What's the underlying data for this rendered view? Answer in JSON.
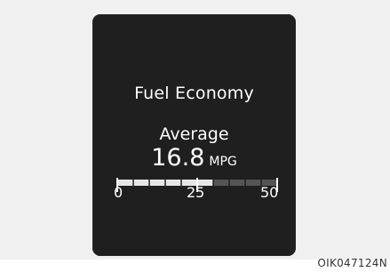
{
  "display": {
    "title": "Fuel Economy",
    "mode_label": "Average",
    "value": "16.8",
    "unit": "MPG"
  },
  "gauge": {
    "min_label": "0",
    "mid_label": "25",
    "max_label": "50",
    "min": 0,
    "max": 50,
    "segment_count": 10,
    "lit_segments": 6,
    "fill_fraction": 0.6,
    "colors": {
      "lit": "#e6e6e6",
      "unlit": "#555555",
      "tick": "#ffffff"
    }
  },
  "figure_code": "OIK047124N"
}
